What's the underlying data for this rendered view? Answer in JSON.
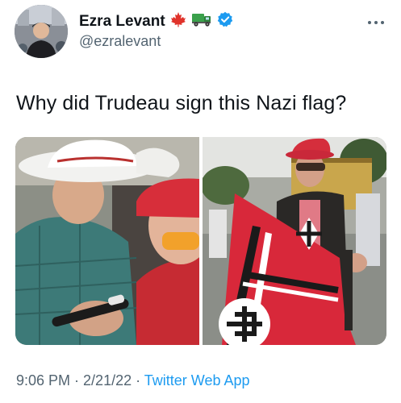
{
  "author": {
    "display_name": "Ezra Levant",
    "handle": "@ezralevant",
    "badges": [
      "maple-leaf-icon",
      "truck-icon",
      "verified-badge-icon"
    ]
  },
  "menu_icon": "more-options-icon",
  "tweet": {
    "text": "Why did Trudeau sign this Nazi flag?"
  },
  "media": {
    "count": 2
  },
  "meta": {
    "time": "9:06 PM",
    "separator1": " · ",
    "date": "2/21/22",
    "separator2": " · ",
    "source": "Twitter Web App"
  },
  "colors": {
    "verified": "#1d9bf0",
    "link": "#1d9bf0",
    "secondary_text": "#536471",
    "flag_red": "#d8283a"
  }
}
